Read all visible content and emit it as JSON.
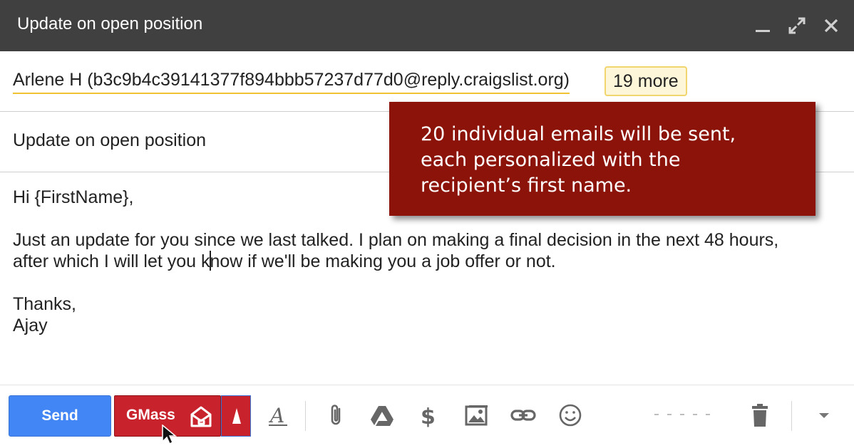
{
  "window": {
    "title": "Update on open position"
  },
  "titlebar_icons": [
    "minimize-icon",
    "expand-icon",
    "close-icon"
  ],
  "recipients": {
    "to": "Arlene H (b3c9b4c39141377f894bbb57237d77d0@reply.craigslist.org)",
    "more": "19 more"
  },
  "subject": "Update on open position",
  "body": {
    "greeting": "Hi {FirstName},",
    "line1": "Just an update for you since we last talked. I plan on making a final decision in the next 48 hours,",
    "line2_before_caret": "after which I will let you k",
    "line2_after_caret": "now if we'll be making you a job offer or not.",
    "signoff": "Thanks,",
    "signature": "Ajay"
  },
  "callout": {
    "line1": "20 individual emails will be sent,",
    "line2": "each personalized with the",
    "line3": "recipient’s first name."
  },
  "toolbar": {
    "send_label": "Send",
    "gmass_label": "GMass",
    "icons": [
      "formatting-icon",
      "attach-icon",
      "drive-icon",
      "money-icon",
      "photo-icon",
      "link-icon",
      "emoji-icon",
      "trash-icon",
      "more-options-icon"
    ]
  },
  "colors": {
    "titlebar": "#404040",
    "send_blue": "#4285f4",
    "gmass_red": "#c8232c",
    "callout_red": "#8b1309",
    "recipient_underline": "#f1c232",
    "chip_bg": "#fdf6d8"
  }
}
